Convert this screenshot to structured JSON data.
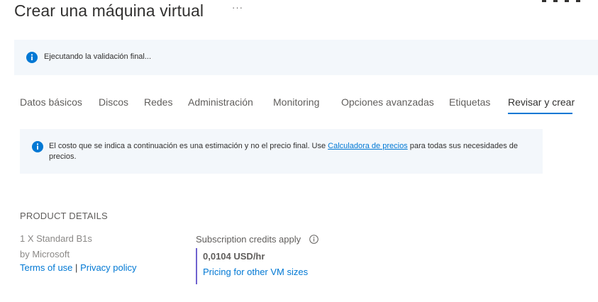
{
  "header": {
    "title": "Crear una máquina virtual",
    "more_label": "···"
  },
  "banner": {
    "icon": "info-icon",
    "text": "Ejecutando la validación final..."
  },
  "tabs": [
    {
      "label": "Datos básicos",
      "active": false
    },
    {
      "label": "Discos",
      "active": false
    },
    {
      "label": "Redes",
      "active": false
    },
    {
      "label": "Administración",
      "active": false
    },
    {
      "label": "Monitoring",
      "active": false
    },
    {
      "label": "Opciones avanzadas",
      "active": false
    },
    {
      "label": "Etiquetas",
      "active": false
    },
    {
      "label": "Revisar y crear",
      "active": true
    }
  ],
  "notice": {
    "icon": "info-icon",
    "text_before": "El costo que se indica a continuación es una estimación y no el precio final. Use ",
    "link": "Calculadora de precios",
    "text_after": " para todas sus necesidades de precios."
  },
  "product": {
    "section_title": "PRODUCT DETAILS",
    "name": "1 X Standard B1s",
    "vendor": "by Microsoft",
    "terms_link": "Terms of use",
    "separator": "|",
    "privacy_link": "Privacy policy",
    "credits_label": "Subscription credits apply",
    "price": "0,0104 USD/hr",
    "pricing_link": "Pricing for other VM sizes"
  },
  "colors": {
    "accent": "#0078d4",
    "banner_bg": "#f3f7fb",
    "price_bar": "#6f62cf"
  }
}
